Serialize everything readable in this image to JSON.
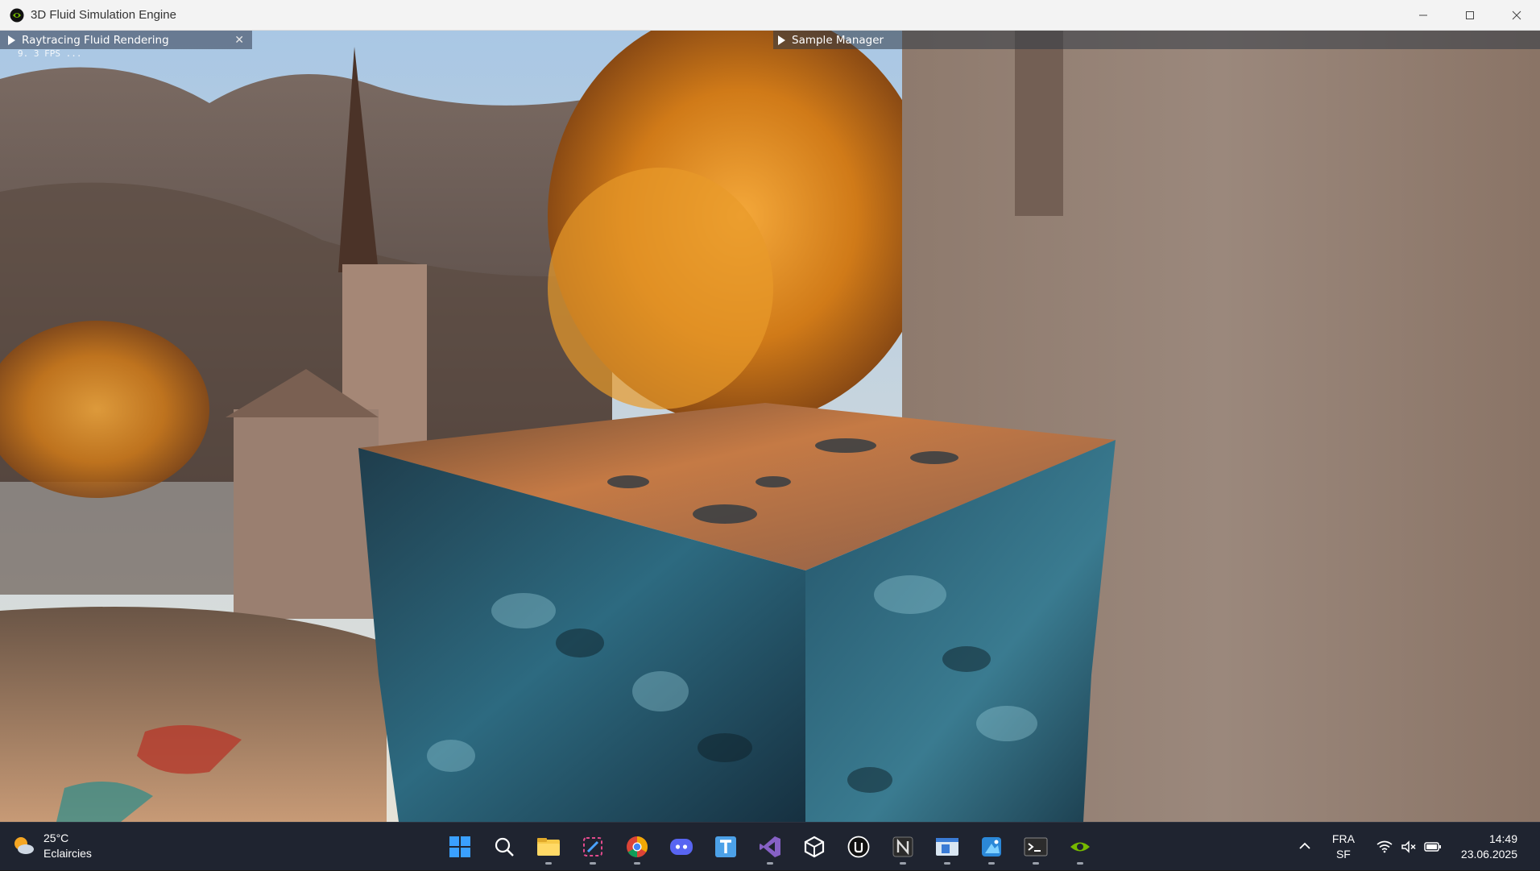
{
  "window": {
    "title": "3D Fluid Simulation Engine",
    "logo_icon": "nvidia-icon",
    "controls": [
      "minimize-icon",
      "maximize-icon",
      "close-icon"
    ]
  },
  "panels": {
    "left": {
      "title": "Raytracing Fluid Rendering",
      "expand_icon": "triangle-right-icon",
      "close_icon": "close-icon"
    },
    "right": {
      "title": "Sample Manager",
      "expand_icon": "triangle-right-icon"
    }
  },
  "overlay": {
    "fps_text": "9. 3 FPS ..."
  },
  "taskbar": {
    "weather": {
      "temperature": "25°C",
      "condition": "Eclaircies",
      "icon": "partly-sunny-icon"
    },
    "apps": [
      {
        "name": "windows-start-icon",
        "active": false
      },
      {
        "name": "search-icon",
        "active": false
      },
      {
        "name": "file-explorer-icon",
        "active": true
      },
      {
        "name": "snipping-tool-icon",
        "active": true
      },
      {
        "name": "chrome-icon",
        "active": true
      },
      {
        "name": "discord-icon",
        "active": false
      },
      {
        "name": "typora-icon",
        "active": false
      },
      {
        "name": "visual-studio-icon",
        "active": true
      },
      {
        "name": "unity-icon",
        "active": false
      },
      {
        "name": "unreal-engine-icon",
        "active": false
      },
      {
        "name": "notion-icon",
        "active": true
      },
      {
        "name": "app-window-icon",
        "active": true
      },
      {
        "name": "paint-icon",
        "active": true
      },
      {
        "name": "terminal-icon",
        "active": true
      },
      {
        "name": "nvidia-icon",
        "active": true
      }
    ],
    "tray": {
      "chevron_icon": "chevron-up-icon",
      "language": "FRA",
      "layout": "SF",
      "icons": [
        "wifi-icon",
        "speaker-muted-icon",
        "battery-icon"
      ],
      "time": "14:49",
      "date": "23.06.2025"
    }
  },
  "colors": {
    "panel_active": "#5e7086",
    "taskbar_bg": "#1f2430",
    "titlebar_bg": "#f3f3f3"
  }
}
